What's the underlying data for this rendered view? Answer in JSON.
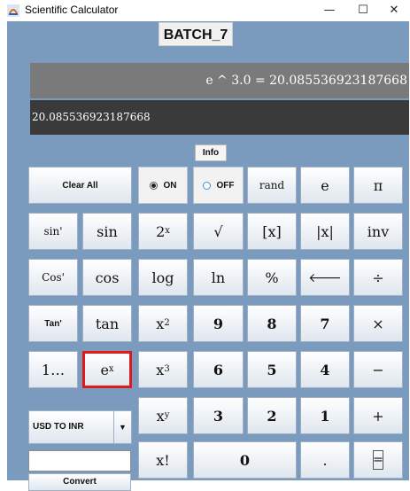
{
  "window": {
    "title": "Scientific Calculator",
    "controls": {
      "minimize": "—",
      "maximize": "☐",
      "close": "✕"
    }
  },
  "header": {
    "batch_label": "BATCH_7"
  },
  "screen": {
    "history": "e ^ 3.0 = 20.085536923187668",
    "value": "20.085536923187668"
  },
  "info_label": "Info",
  "buttons": {
    "clear_all": "Clear All",
    "on": "ON",
    "off": "OFF",
    "rand": "rand",
    "e": "e",
    "pi": "π",
    "sin_inv": "sin'",
    "sin": "sin",
    "two_pow_x_base": "2",
    "pow_x_sup": "x",
    "sqrt": "√",
    "floor": "[x]",
    "abs": "|x|",
    "inv": "inv",
    "cos_inv": "Cos'",
    "cos": "cos",
    "log": "log",
    "ln": "ln",
    "percent": "%",
    "backspace": "🡐",
    "divide": "÷",
    "tan_inv": "Tan'",
    "tan": "tan",
    "x_base": "x",
    "sq_sup": "2",
    "cube_sup": "3",
    "y_sup": "y",
    "nine": "9",
    "eight": "8",
    "seven": "7",
    "multiply": "×",
    "one_dots": "1…",
    "e_base": "e",
    "six": "6",
    "five": "5",
    "four": "4",
    "minus": "−",
    "three": "3",
    "two": "2",
    "one": "1",
    "plus": "+",
    "factorial": "x!",
    "zero": "0",
    "dot": ".",
    "equals": "="
  },
  "converter": {
    "selected": "USD TO INR",
    "arrow": "▼",
    "input_value": "",
    "button": "Convert"
  },
  "colors": {
    "panel": "#7a9bbe",
    "history_bg": "#7a7a7a",
    "display_bg": "#3a3a3a",
    "highlight": "#e01a1a"
  }
}
